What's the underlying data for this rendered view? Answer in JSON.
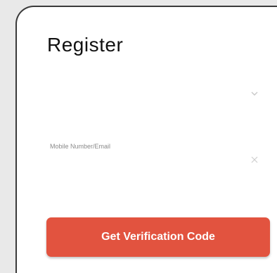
{
  "page": {
    "title": "Register"
  },
  "region_select": {
    "value": "",
    "icon": "chevron-down-icon"
  },
  "account_field": {
    "value": "",
    "placeholder": "Mobile Number/Email",
    "clear_icon": "close-icon"
  },
  "actions": {
    "primary_label": "Get Verification Code"
  },
  "colors": {
    "primary": "#e2533f",
    "text": "#111111",
    "placeholder": "#8a8a8a",
    "icon_muted": "#c8c8c8",
    "card_border": "#3a3a3a"
  }
}
